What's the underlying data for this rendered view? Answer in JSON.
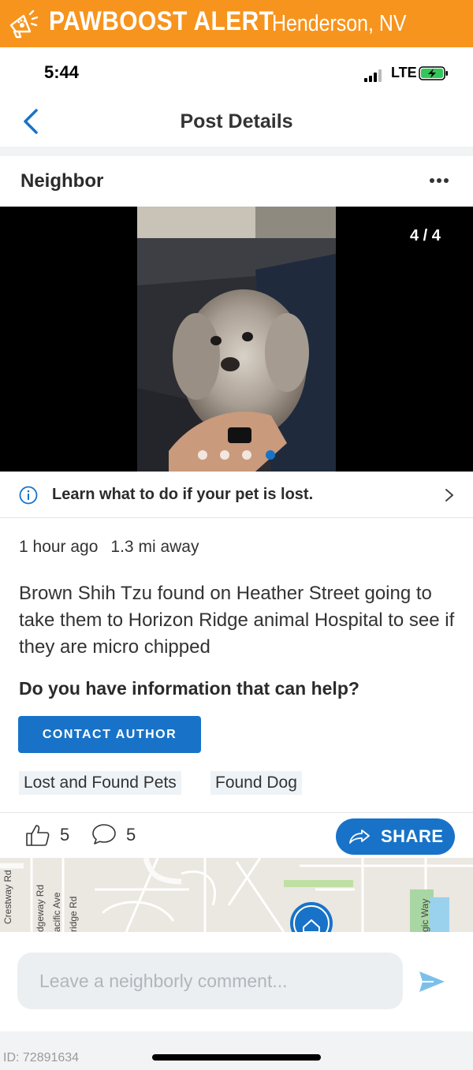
{
  "alert_banner": {
    "brand": "PAWBOOST ALERT",
    "location": "Henderson, NV",
    "icon": "megaphone-paw-icon",
    "color": "#f7941d"
  },
  "status_bar": {
    "time": "5:44",
    "network": "LTE",
    "signal_icon": "cellular-signal-icon",
    "battery_icon": "battery-charging-icon"
  },
  "nav": {
    "title": "Post Details",
    "back_icon": "chevron-left-icon"
  },
  "post": {
    "author": "Neighbor",
    "more_icon": "ellipsis-icon",
    "photo": {
      "counter": "4 / 4",
      "total_images": 4,
      "active_index": 4,
      "description_icon": "dog-photo"
    },
    "learn_link": "Learn what to do if your pet is lost.",
    "time_ago": "1 hour ago",
    "distance": "1.3 mi away",
    "description": "Brown Shih Tzu found on Heather Street going to take them to Horizon Ridge animal Hospital to see if they are micro chipped",
    "help_question": "Do you have information that can help?",
    "contact_button": "CONTACT AUTHOR",
    "tags": [
      "Lost and Found Pets",
      "Found Dog"
    ],
    "likes": "5",
    "comments": "5",
    "share_button": "SHARE"
  },
  "map": {
    "streets": [
      "Crestway Rd",
      "dgeway Rd",
      "acific Ave",
      "ridge Rd",
      "gic Way"
    ]
  },
  "comment_bar": {
    "placeholder": "Leave a neighborly comment...",
    "send_icon": "send-icon"
  },
  "footer": {
    "post_id": "ID: 72891634"
  },
  "colors": {
    "accent": "#1873c8",
    "banner": "#f7941d"
  }
}
